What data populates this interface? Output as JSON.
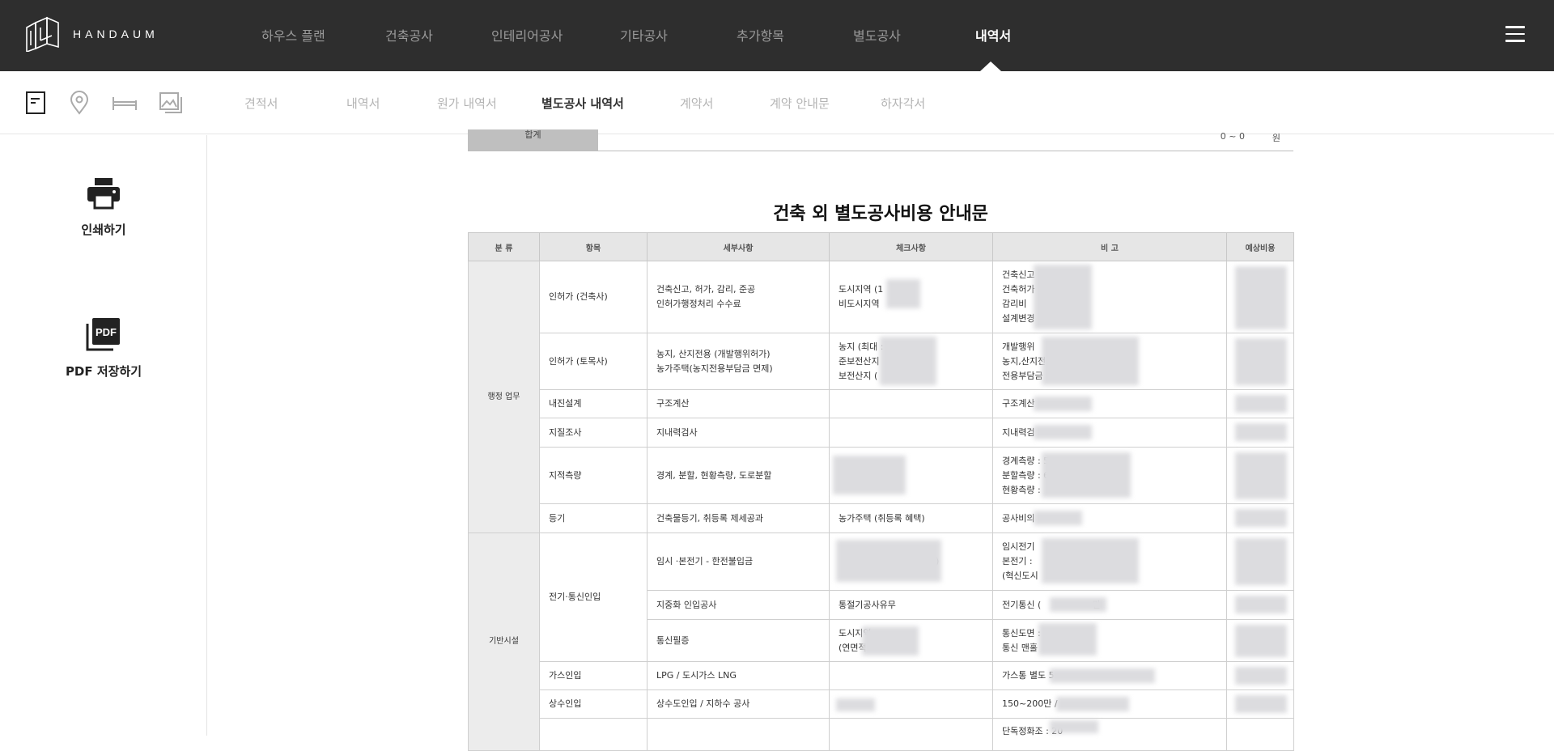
{
  "brand": {
    "name": "HANDAUM"
  },
  "mainnav": [
    {
      "label": "하우스 플랜"
    },
    {
      "label": "건축공사"
    },
    {
      "label": "인테리어공사"
    },
    {
      "label": "기타공사"
    },
    {
      "label": "추가항목"
    },
    {
      "label": "별도공사"
    },
    {
      "label": "내역서"
    }
  ],
  "active_mainnav": "내역서",
  "subnav": {
    "icons": [
      "document-icon",
      "location-pin-icon",
      "bed-icon",
      "image-icon"
    ],
    "tabs": [
      {
        "label": "견적서"
      },
      {
        "label": "내역서"
      },
      {
        "label": "원가 내역서"
      },
      {
        "label": "별도공사 내역서"
      },
      {
        "label": "계약서"
      },
      {
        "label": "계약 안내문"
      },
      {
        "label": "하자각서"
      }
    ],
    "active_tab": "별도공사 내역서"
  },
  "actions": {
    "print_label": "인쇄하기",
    "pdf_label": "PDF 저장하기",
    "pdf_icon_text": "PDF"
  },
  "total": {
    "label": "합계",
    "value": "0 ~ 0",
    "unit": "원"
  },
  "guide": {
    "title": "건축 외 별도공사비용 안내문",
    "headers": [
      "분 류",
      "항목",
      "세부사항",
      "체크사항",
      "비 고",
      "예상비용"
    ],
    "categories": {
      "admin": "행정 업무",
      "infra": "기반시설"
    },
    "rows": [
      {
        "item": "인허가 (건축사)",
        "detail": [
          "건축신고, 허가, 감리, 준공",
          "인허가행정처리 수수료"
        ],
        "check": [
          "도시지역 (1",
          "비도시지역"
        ],
        "note": [
          "건축신고",
          "건축허가",
          "감리비",
          "설계변경"
        ]
      },
      {
        "item": "인허가 (토목사)",
        "detail": [
          "농지, 산지전용 (개발행위허가)",
          "농가주택(농지전용부담금 면제)"
        ],
        "check": [
          "농지 (최대 :",
          "준보전산지",
          "보전산지 ("
        ],
        "note": [
          "개발행위",
          "농지,산지전",
          "전용부담금 :"
        ]
      },
      {
        "item": "내진설계",
        "detail": [
          "구조계산"
        ],
        "check": [],
        "note": [
          "구조계산"
        ]
      },
      {
        "item": "지질조사",
        "detail": [
          "지내력검사"
        ],
        "check": [],
        "note": [
          "지내력검"
        ]
      },
      {
        "item": "지적측량",
        "detail": [
          "경계, 분할, 현황측량, 도로분할"
        ],
        "check": [],
        "note": [
          "경계측량 : 5",
          "분할측량 : 6",
          "현황측량 :"
        ]
      },
      {
        "item": "등기",
        "detail": [
          "건축물등기, 취등록 제세공과"
        ],
        "check": [
          "농가주택 (취등록 혜택)"
        ],
        "note": [
          "공사비의"
        ]
      },
      {
        "item": "전기·통신인입",
        "detail": [
          "임시 ·본전기 - 한전불입금"
        ],
        "check": [
          ")"
        ],
        "note": [
          "임시전기",
          "본전기 :",
          "(혁신도시"
        ]
      },
      {
        "item": "",
        "detail": [
          "지중화 인입공사"
        ],
        "check": [
          "통절기공사유무"
        ],
        "note": [
          "전기통신 (",
          "만"
        ]
      },
      {
        "item": "",
        "detail": [
          "통신필증"
        ],
        "check": [
          "도시지역",
          "(연면적"
        ],
        "note": [
          "통신도면 :",
          "통신 맨홀"
        ]
      },
      {
        "item": "가스인입",
        "detail": [
          "LPG / 도시가스 LNG"
        ],
        "check": [],
        "note": [
          "가스통 별도 5"
        ]
      },
      {
        "item": "상수인입",
        "detail": [
          "상수도인입 / 지하수 공사"
        ],
        "check": [],
        "note": [
          "150~200만 /"
        ]
      },
      {
        "item": "",
        "detail": [],
        "check": [],
        "note": [
          "단독정화조 : 20"
        ]
      }
    ]
  }
}
